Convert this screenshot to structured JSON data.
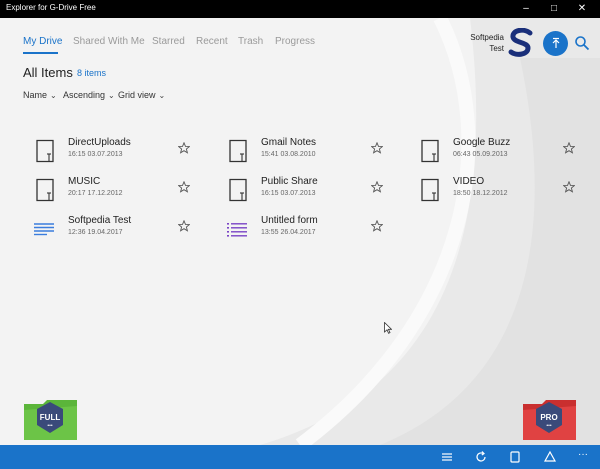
{
  "window": {
    "title": "Explorer for G-Drive Free"
  },
  "nav": {
    "tabs": [
      {
        "label": "My Drive"
      },
      {
        "label": "Shared With Me"
      },
      {
        "label": "Starred"
      },
      {
        "label": "Recent"
      },
      {
        "label": "Trash"
      },
      {
        "label": "Progress"
      }
    ]
  },
  "user": {
    "first": "Softpedia",
    "last": "Test",
    "logo_letter": "S"
  },
  "header": {
    "title": "All Items",
    "count": "8 items"
  },
  "sort": {
    "by": "Name",
    "order": "Ascending",
    "view": "Grid view"
  },
  "files": [
    {
      "name": "DirectUploads",
      "date": "16:15 03.07.2013",
      "icon": "folder-icon"
    },
    {
      "name": "Gmail Notes",
      "date": "15:41 03.08.2010",
      "icon": "folder-icon"
    },
    {
      "name": "Google Buzz",
      "date": "06:43 05.09.2013",
      "icon": "folder-icon"
    },
    {
      "name": "MUSIC",
      "date": "20:17 17.12.2012",
      "icon": "folder-icon"
    },
    {
      "name": "Public Share",
      "date": "16:15 03.07.2013",
      "icon": "folder-icon"
    },
    {
      "name": "VIDEO",
      "date": "18:50 18.12.2012",
      "icon": "folder-icon"
    },
    {
      "name": "Softpedia Test",
      "date": "12:36 19.04.2017",
      "icon": "document-icon"
    },
    {
      "name": "Untitled form",
      "date": "13:55 26.04.2017",
      "icon": "form-icon"
    }
  ],
  "badges": {
    "full": "FULL",
    "pro": "PRO"
  },
  "colors": {
    "accent": "#1a73c9",
    "document": "#3b7ddd",
    "form": "#7a45c5",
    "full_badge": "#5bb53a",
    "pro_badge": "#d93a3a",
    "badge_center": "#3a4a7a"
  }
}
